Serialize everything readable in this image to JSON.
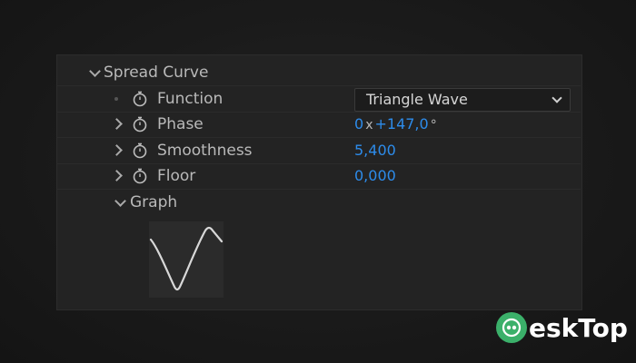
{
  "spread_curve": {
    "label": "Spread Curve",
    "function": {
      "label": "Function",
      "value": "Triangle Wave"
    },
    "phase": {
      "label": "Phase",
      "revolutions": "0",
      "x_symbol": "x",
      "degrees": "+147,0",
      "degree_symbol": "°"
    },
    "smoothness": {
      "label": "Smoothness",
      "value": "5,400"
    },
    "floor": {
      "label": "Floor",
      "value": "0,000"
    },
    "graph": {
      "label": "Graph"
    }
  },
  "watermark": {
    "text": "eskTop"
  },
  "icons": {
    "expand": "chevron-down-icon",
    "collapse": "chevron-right-icon",
    "keyframe": "stopwatch-icon",
    "logo": "logo-icon"
  },
  "colors": {
    "value_blue": "#2d8ceb",
    "brand_green": "#3bb06a"
  }
}
